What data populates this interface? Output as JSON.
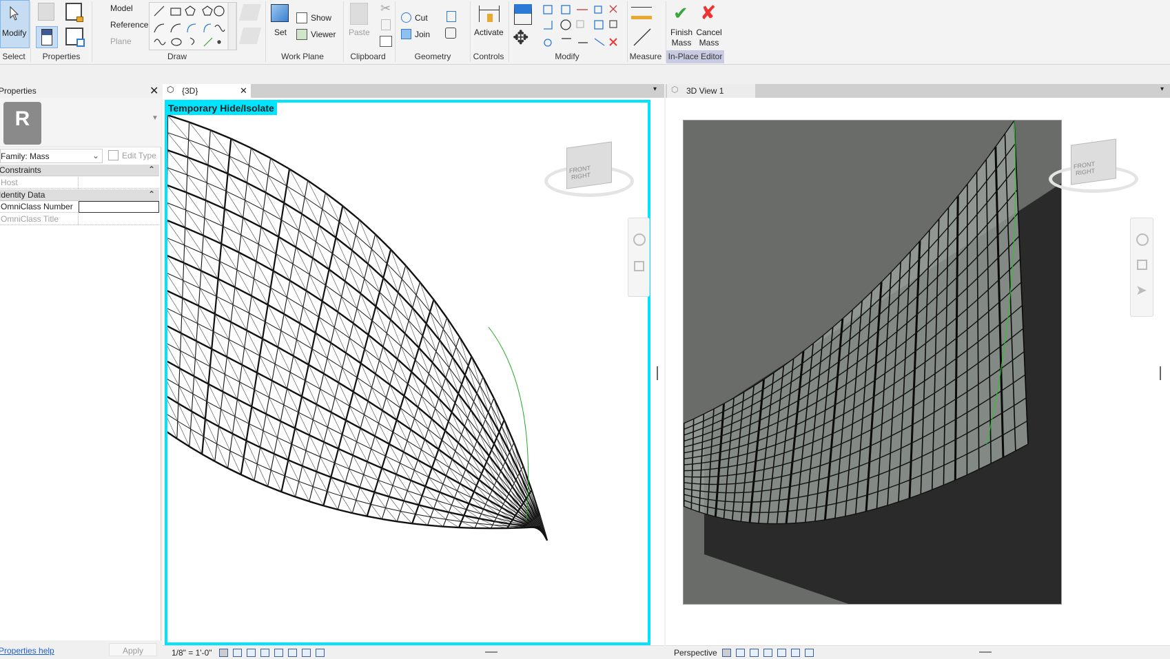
{
  "ribbon": {
    "modify_label": "Modify",
    "panels": [
      "Select",
      "Properties",
      "Draw",
      "Work Plane",
      "Clipboard",
      "Geometry",
      "Controls",
      "Modify",
      "Measure",
      "In-Place Editor"
    ],
    "model": "Model",
    "reference": "Reference",
    "plane": "Plane",
    "set": "Set",
    "show": "Show",
    "viewer": "Viewer",
    "paste": "Paste",
    "cut": "Cut",
    "join": "Join",
    "activate": "Activate",
    "finish_mass_1": "Finish",
    "finish_mass_2": "Mass",
    "cancel_mass_1": "Cancel",
    "cancel_mass_2": "Mass",
    "accent": "#c9cbe3"
  },
  "properties": {
    "title": "Properties",
    "type_icon": "R",
    "family": "Family: Mass",
    "edit_type": "Edit Type",
    "sections": [
      {
        "name": "Constraints",
        "rows": [
          {
            "label": "Host",
            "value": ""
          }
        ]
      },
      {
        "name": "Identity Data",
        "rows": [
          {
            "label": "OmniClass Number",
            "value": ""
          },
          {
            "label": "OmniClass Title",
            "value": ""
          }
        ]
      }
    ],
    "help": "Properties help",
    "apply": "Apply"
  },
  "views": {
    "left": {
      "tab": "{3D}",
      "banner": "Temporary Hide/Isolate",
      "scale": "1/8\" = 1'-0\"",
      "frame_color": "#00e5ff"
    },
    "right": {
      "tab": "3D View 1",
      "mode": "Perspective"
    },
    "viewcube": {
      "front": "FRONT",
      "right": "RIGHT"
    }
  }
}
